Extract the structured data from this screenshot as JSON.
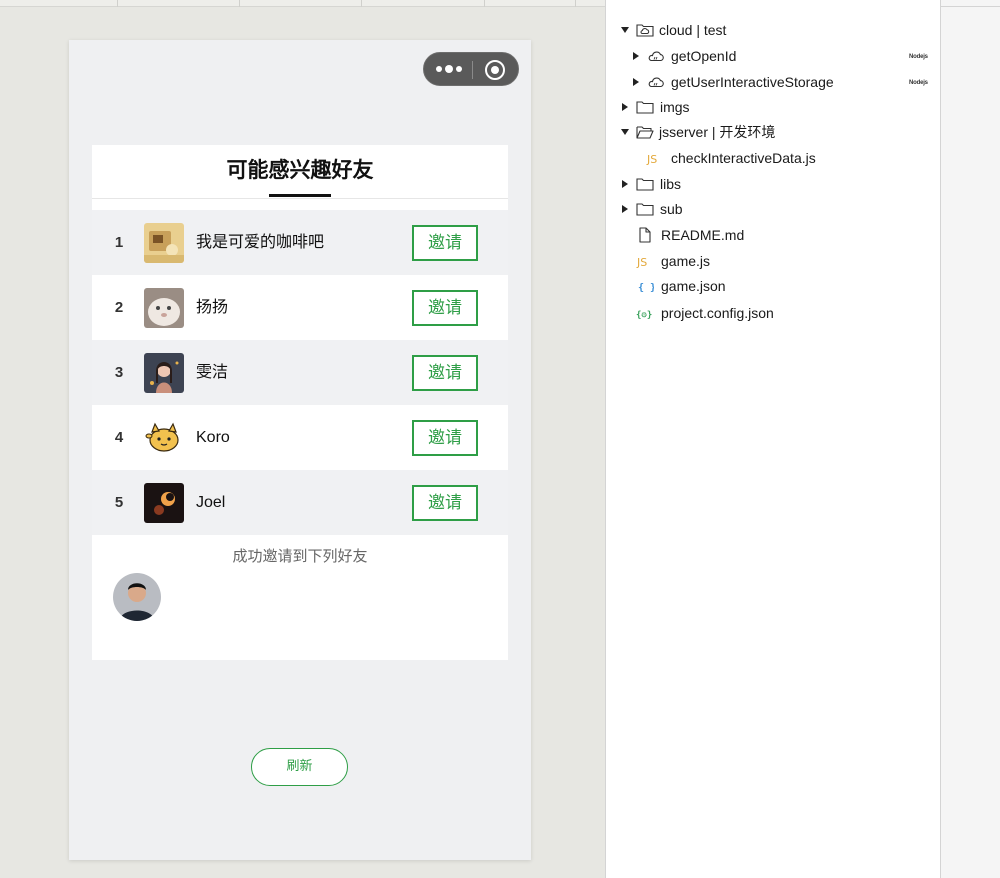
{
  "simulator": {
    "panel_title": "可能感兴趣好友",
    "invite_label": "邀请",
    "friends": [
      {
        "rank": "1",
        "name": "我是可爱的咖啡吧"
      },
      {
        "rank": "2",
        "name": "扬扬"
      },
      {
        "rank": "3",
        "name": "雯洁"
      },
      {
        "rank": "4",
        "name": "Koro"
      },
      {
        "rank": "5",
        "name": "Joel"
      }
    ],
    "success_label": "成功邀请到下列好友",
    "refresh_label": "刷新"
  },
  "explorer": {
    "node_badge": "Nodejs",
    "items": [
      {
        "label": "cloud | test",
        "icon": "cloud-folder-icon",
        "state": "expanded"
      },
      {
        "label": "getOpenId",
        "icon": "cloud-function-icon",
        "state": "collapsed"
      },
      {
        "label": "getUserInteractiveStorage",
        "icon": "cloud-function-icon",
        "state": "collapsed"
      },
      {
        "label": "imgs",
        "icon": "folder-icon",
        "state": "collapsed"
      },
      {
        "label": "jsserver | 开发环境",
        "icon": "folder-open-icon",
        "state": "expanded"
      },
      {
        "label": "checkInteractiveData.js",
        "icon": "js-file-icon"
      },
      {
        "label": "libs",
        "icon": "folder-icon",
        "state": "collapsed"
      },
      {
        "label": "sub",
        "icon": "folder-icon",
        "state": "collapsed"
      },
      {
        "label": "README.md",
        "icon": "file-icon"
      },
      {
        "label": "game.js",
        "icon": "js-file-icon"
      },
      {
        "label": "game.json",
        "icon": "json-file-icon"
      },
      {
        "label": "project.config.json",
        "icon": "config-file-icon"
      }
    ]
  },
  "colors": {
    "accent_green": "#2e9e46",
    "js_orange": "#e3a83a",
    "json_blue": "#3b8fd6",
    "config_green": "#3aa15c"
  }
}
